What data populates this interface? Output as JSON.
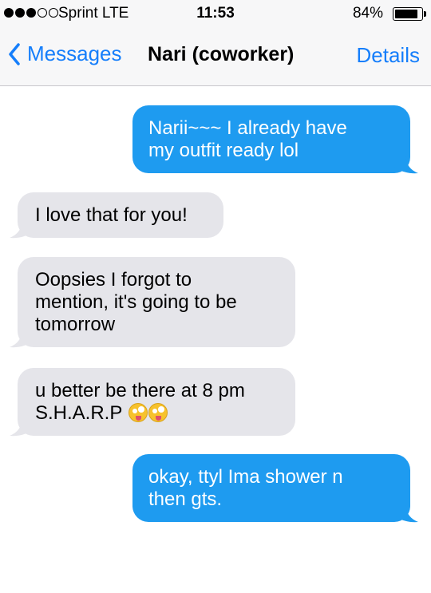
{
  "status_bar": {
    "carrier": "Sprint  LTE",
    "time": "11:53",
    "battery_percent": "84%",
    "battery_level": 0.84
  },
  "nav": {
    "back_label": "Messages",
    "title": "Nari (coworker)",
    "details_label": "Details"
  },
  "messages": [
    {
      "direction": "outgoing",
      "lines": [
        "Narii~~~ I already have",
        "my outfit ready lol"
      ]
    },
    {
      "direction": "incoming",
      "lines": [
        "I love that for you!"
      ]
    },
    {
      "direction": "incoming",
      "lines": [
        "Oopsies I forgot to",
        "mention, it's going to be",
        "tomorrow"
      ]
    },
    {
      "direction": "incoming",
      "lines": [
        "u better be there at 8 pm",
        "S.H.A.R.P"
      ],
      "emojis": [
        "zany-face-emoji",
        "zany-face-emoji"
      ]
    },
    {
      "direction": "outgoing",
      "lines": [
        "okay, ttyl Ima shower n",
        "then gts."
      ]
    }
  ],
  "colors": {
    "accent": "#157efb",
    "outgoing_bubble": "#1e9bf0",
    "incoming_bubble": "#e5e5ea",
    "bar_background": "#f7f7f8"
  }
}
